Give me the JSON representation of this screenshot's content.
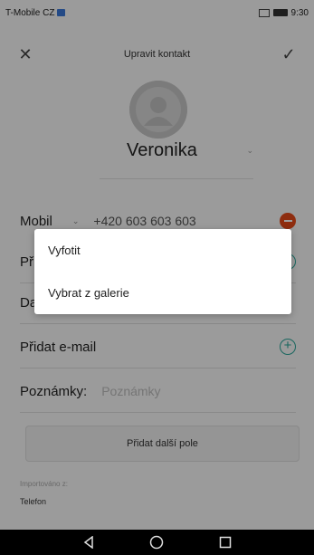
{
  "status_bar": {
    "carrier": "T-Mobile CZ",
    "time": "9:30"
  },
  "top_bar": {
    "title": "Upravit kontakt",
    "close_icon": "close-icon",
    "confirm_icon": "check-icon"
  },
  "contact": {
    "name": "Veronika"
  },
  "fields": {
    "phone": {
      "label": "Mobil",
      "value": "+420 603 603 603"
    },
    "partial_1": {
      "label": "Př"
    },
    "partial_2": {
      "label": "Da"
    },
    "email": {
      "label": "Přidat e-mail"
    },
    "notes": {
      "label": "Poznámky:",
      "placeholder": "Poznámky"
    }
  },
  "add_field_button": "Přidat další pole",
  "import": {
    "label": "Importováno z:",
    "value": "Telefon"
  },
  "dialog": {
    "items": [
      "Vyfotit",
      "Vybrat z galerie"
    ]
  },
  "colors": {
    "remove": "#e64a19",
    "add": "#2aa69a"
  }
}
